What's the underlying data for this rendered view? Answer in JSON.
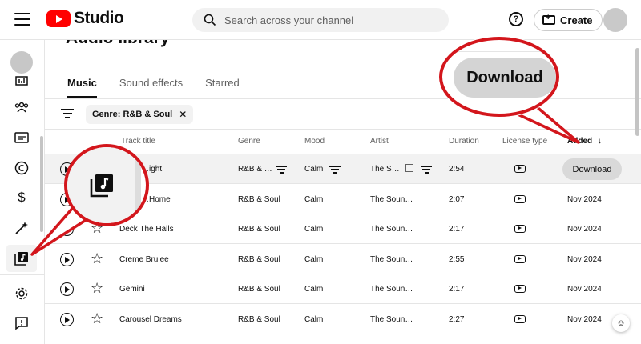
{
  "header": {
    "logo_text": "Studio",
    "search_placeholder": "Search across your channel",
    "help_label": "?",
    "create_label": "Create"
  },
  "page": {
    "title": "Audio library",
    "tabs": [
      {
        "label": "Music",
        "active": true
      },
      {
        "label": "Sound effects",
        "active": false
      },
      {
        "label": "Starred",
        "active": false
      }
    ],
    "filter_chip": "Genre: R&B & Soul"
  },
  "table": {
    "columns": {
      "track_title": "Track title",
      "genre": "Genre",
      "mood": "Mood",
      "artist": "Artist",
      "duration": "Duration",
      "license_type": "License type",
      "added": "Added"
    },
    "sort_indicator": "↓",
    "rows": [
      {
        "title": "…ight",
        "genre": "R&B & …",
        "mood": "Calm",
        "artist": "The S…",
        "duration": "2:54",
        "added": "",
        "action": "Download"
      },
      {
        "title": "…Home",
        "genre": "R&B & Soul",
        "mood": "Calm",
        "artist": "The Soun…",
        "duration": "2:07",
        "added": "Nov 2024"
      },
      {
        "title": "Deck The Halls",
        "genre": "R&B & Soul",
        "mood": "Calm",
        "artist": "The Soun…",
        "duration": "2:17",
        "added": "Nov 2024"
      },
      {
        "title": "Creme Brulee",
        "genre": "R&B & Soul",
        "mood": "Calm",
        "artist": "The Soun…",
        "duration": "2:55",
        "added": "Nov 2024"
      },
      {
        "title": "Gemini",
        "genre": "R&B & Soul",
        "mood": "Calm",
        "artist": "The Soun…",
        "duration": "2:17",
        "added": "Nov 2024"
      },
      {
        "title": "Carousel Dreams",
        "genre": "R&B & Soul",
        "mood": "Calm",
        "artist": "The Soun…",
        "duration": "2:27",
        "added": "Nov 2024"
      }
    ]
  },
  "callouts": {
    "download_label": "Download"
  },
  "colors": {
    "brand_red": "#ff0000",
    "callout_red": "#d3161c",
    "hover_row": "#f2f2f2",
    "button_gray": "#d9d9d9"
  }
}
